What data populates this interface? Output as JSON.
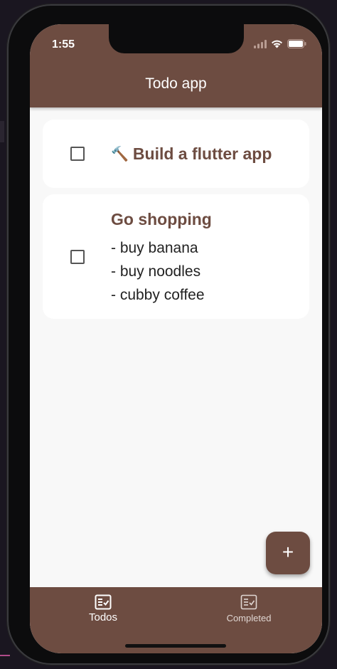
{
  "status": {
    "time": "1:55"
  },
  "app": {
    "title": "Todo app"
  },
  "todos": [
    {
      "emoji": "🔨",
      "title": "Build a flutter app",
      "description": ""
    },
    {
      "title": "Go shopping",
      "description": "- buy banana\n- buy noodles\n- cubby coffee"
    }
  ],
  "fab": {
    "label": "+"
  },
  "nav": {
    "todos_label": "Todos",
    "completed_label": "Completed"
  },
  "colors": {
    "primary": "#6d4c41",
    "background": "#f8f8f8",
    "card": "#ffffff"
  },
  "icons": {
    "todos_tab": "checklist-icon",
    "completed_tab": "checklist-icon",
    "fab": "plus-icon"
  }
}
